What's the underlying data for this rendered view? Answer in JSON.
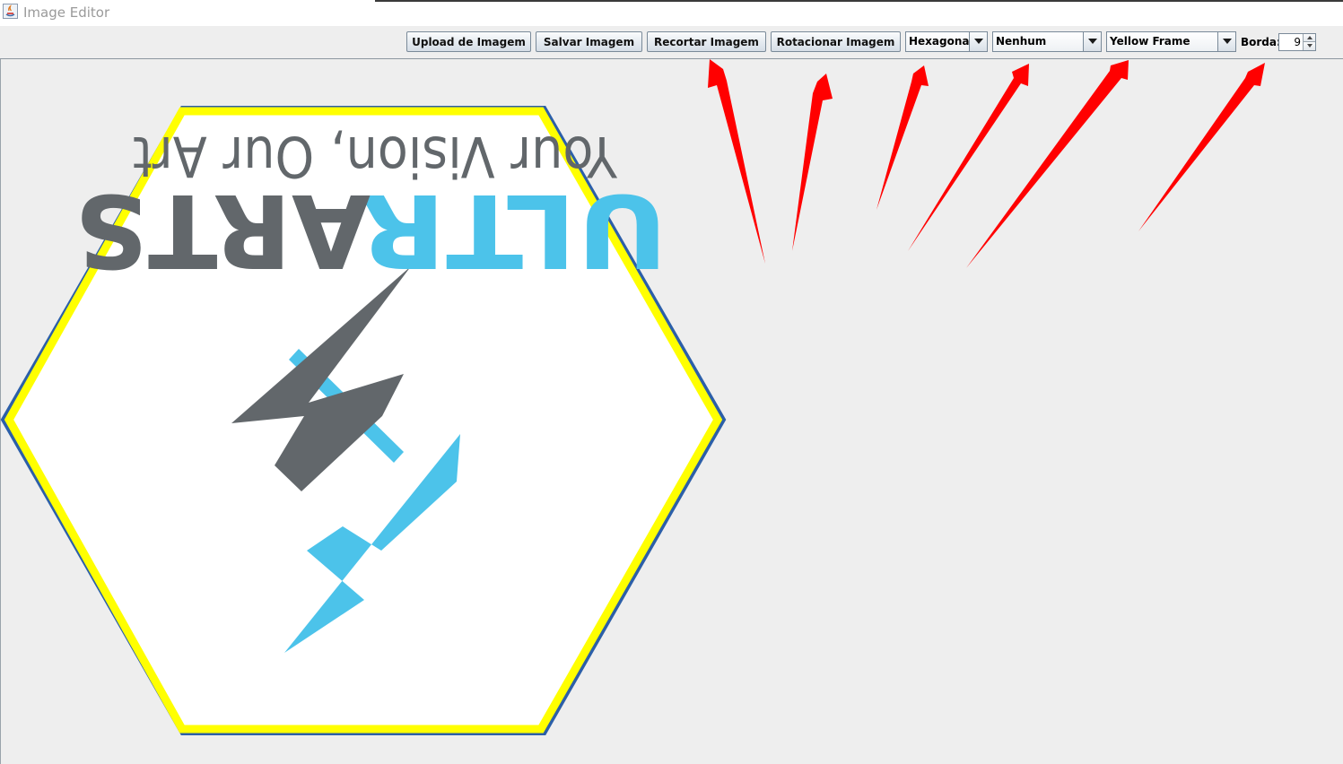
{
  "window": {
    "title": "Image Editor"
  },
  "toolbar": {
    "upload_label": "Upload de Imagem",
    "save_label": "Salvar Imagem",
    "crop_label": "Recortar Imagem",
    "rotate_label": "Rotacionar Imagem",
    "shape_select": {
      "value": "Hexagonal"
    },
    "filter_select": {
      "value": "Nenhum"
    },
    "frame_select": {
      "value": "Yellow Frame"
    },
    "border_label": "Borda:",
    "border_value": "9"
  },
  "image": {
    "tagline": "Your Vision, Our Art",
    "brand_ultr": "ULTR",
    "brand_arts": "ARTS",
    "frame_color": "#ffff00",
    "brand_blue": "#4cc3ea",
    "brand_gray": "#62676b",
    "rotation_deg": 180
  },
  "annotation": {
    "arrow_color": "#ff0000"
  }
}
